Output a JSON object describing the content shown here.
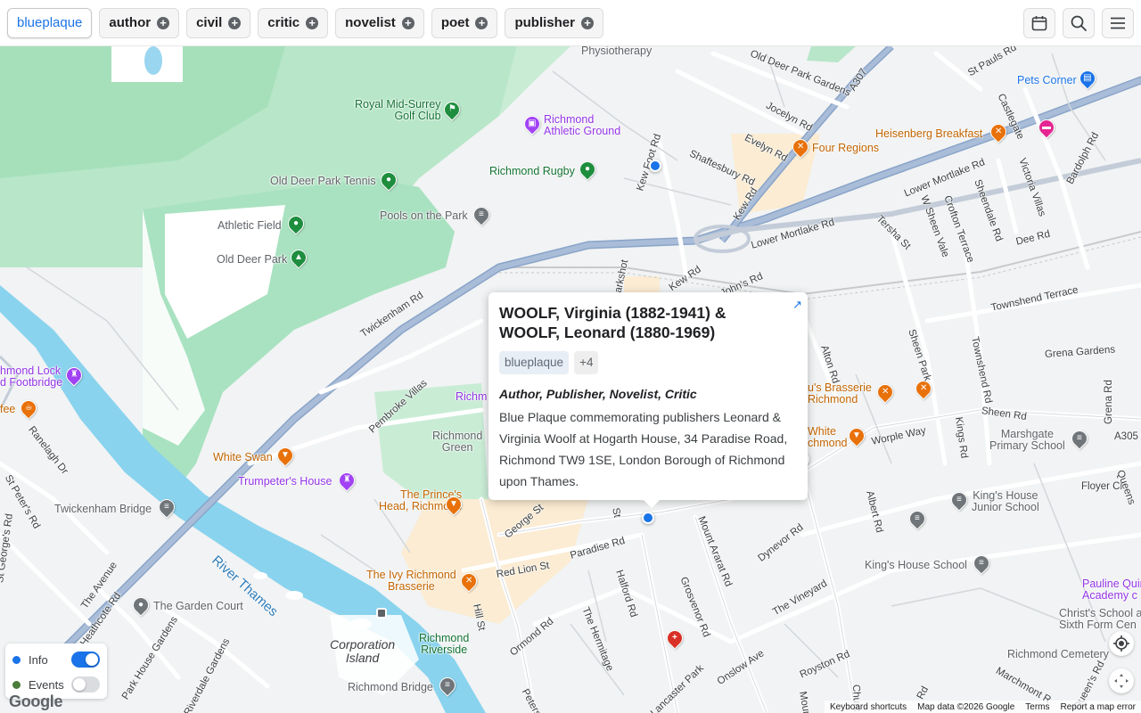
{
  "filters": [
    {
      "label": "blueplaque",
      "active": true
    },
    {
      "label": "author",
      "active": false
    },
    {
      "label": "civil",
      "active": false
    },
    {
      "label": "critic",
      "active": false
    },
    {
      "label": "novelist",
      "active": false
    },
    {
      "label": "poet",
      "active": false
    },
    {
      "label": "publisher",
      "active": false
    }
  ],
  "filter_add_symbol": "+",
  "toolbar_icons": [
    "calendar-icon",
    "search-icon",
    "menu-icon"
  ],
  "popup": {
    "title": "WOOLF, Virginia (1882-1941) & WOOLF, Leonard (1880-1969)",
    "tag_primary": "blueplaque",
    "tag_more": "+4",
    "roles": "Author, Publisher, Novelist, Critic",
    "description": "Blue Plaque commemorating publishers Leonard & Virginia Woolf at Hogarth House, 34 Paradise Road, Richmond TW9 1SE, London Borough of Richmond upon Thames.",
    "expand_icon": "↗"
  },
  "legend": {
    "info_label": "Info",
    "info_color": "#1a73e8",
    "info_on": true,
    "events_label": "Events",
    "events_color": "#4a7c3a",
    "events_on": false
  },
  "google_logo": "Google",
  "attribution": {
    "shortcuts": "Keyboard shortcuts",
    "map_data": "Map data ©2026 Google",
    "terms": "Terms",
    "report": "Report a map error"
  },
  "map": {
    "places": {
      "royal_mid_surrey": "Royal Mid-Surrey\nGolf Club",
      "richmond_athletic": "Richmond\nAthletic Ground",
      "richmond_rugby": "Richmond Rugby",
      "old_deer_park_tennis": "Old Deer Park Tennis",
      "athletic_field": "Athletic Field",
      "old_deer_park": "Old Deer Park",
      "pools_on_the_park": "Pools on the Park",
      "physiotherapy": "Physiotherapy",
      "pets_corner": "Pets Corner",
      "heisenberg": "Heisenberg Breakfast",
      "four_regions": "Four Regions",
      "richmond_lock": "hmond Lock\nd Footbridge",
      "fee": "fee",
      "white_swan": "White Swan",
      "trumpeters": "Trumpeter's House",
      "twickenham_bridge": "Twickenham Bridge",
      "princes_head": "The Prince's\nHead, Richmond",
      "ivy_richmond": "The Ivy Richmond\nBrasserie",
      "garden_court": "The Garden Court",
      "corporation_island": "Corporation\nIsland",
      "richmond_riverside": "Richmond\nRiverside",
      "richmond_bridge": "Richmond Bridge",
      "richmond_green": "Richmond\nGreen",
      "richm": "Richm",
      "us_brasserie": "u's Brasserie\nRichmond",
      "white_richmond": "White\nchmond",
      "marshgate": "Marshgate\nPrimary School",
      "kings_house_junior": "King's House\nJunior School",
      "kings_house_school": "King's House School",
      "pauline_quirke": "Pauline Quir\nAcademy c",
      "christs_school": "Christ's School a\nSixth Form Cen",
      "richmond_cemetery": "Richmond Cemetery",
      "river_thames": "River Thames"
    },
    "roads": {
      "twickenham_rd": "Twickenham Rd",
      "lower_mortlake_rd": "Lower Mortlake Rd",
      "lower_mortlake_rd2": "Lower Mortlake Rd",
      "kew_rd": "Kew Rd",
      "kew_rd2": "Kew Rd",
      "kew_foot_rd": "Kew Foot Rd",
      "shaftesbury_rd": "Shaftesbury Rd",
      "evelyn_rd": "Evelyn Rd",
      "jocelyn_rd": "Jocelyn Rd",
      "old_deer_park_gardens": "Old Deer Park Gardens",
      "a307": "A307",
      "st_pauls_rd": "St Pauls Rd",
      "castlegate": "Castlegate",
      "victoria_villas": "Victoria Villas",
      "bardolph_rd": "Bardolph Rd",
      "tersha_st": "Tersha St",
      "w_sheen_vale": "W Sheen Vale",
      "crofton_terrace": "Crofton Terrace",
      "sheendale_rd": "Sheendale Rd",
      "dee_rd": "Dee Rd",
      "townshend_terrace": "Townshend Terrace",
      "grena_gardens": "Grena Gardens",
      "grena_rd": "Grena Rd",
      "sheen_rd": "Sheen Rd",
      "a305": "A305",
      "worple_way": "Worple Way",
      "kings_rd": "Kings Rd",
      "townshend_rd": "Townshend Rd",
      "sheen_park": "Sheen Park",
      "alton_rd": "Alton Rd",
      "albert_rd": "Albert Rd",
      "floyer_cl": "Floyer Cl",
      "parkshot": "Parkshot",
      "st_johns_rd": "St John's Rd",
      "pembroke_villas": "Pembroke Villas",
      "ranelagh_dr": "Ranelagh Dr",
      "st_peters_rd": "St Peter's Rd",
      "st_georges_rd": "St George's Rd",
      "the_avenue": "The Avenue",
      "heathcote_rd": "Heathcote Rd",
      "park_house_gardens": "Park House Gardens",
      "riverdale_gardens": "Riverdale Gardens",
      "red_lion_st": "Red Lion St",
      "paradise_rd": "Paradise Rd",
      "george_st": "George St",
      "hill_st": "Hill St",
      "halford_rd": "Halford Rd",
      "mount_ararat_rd": "Mount Ararat Rd",
      "grosvenor_rd": "Grosvenor Rd",
      "dynevor_rd": "Dynevor Rd",
      "the_vineyard": "The Vineyard",
      "the_hermitage": "The Hermitage",
      "ormond_rd": "Ormond Rd",
      "onslow_ave": "Onslow Ave",
      "royston_rd": "Royston Rd",
      "lancaster_park": "Lancaster Park",
      "petersham": "Petersh",
      "marchmont_r": "Marchmont R",
      "queens_rd": "Queen's Rd",
      "churc": "Churc",
      "mount": "Mount",
      "st": "St",
      "rd": "Rd",
      "queens": "Queens"
    }
  }
}
